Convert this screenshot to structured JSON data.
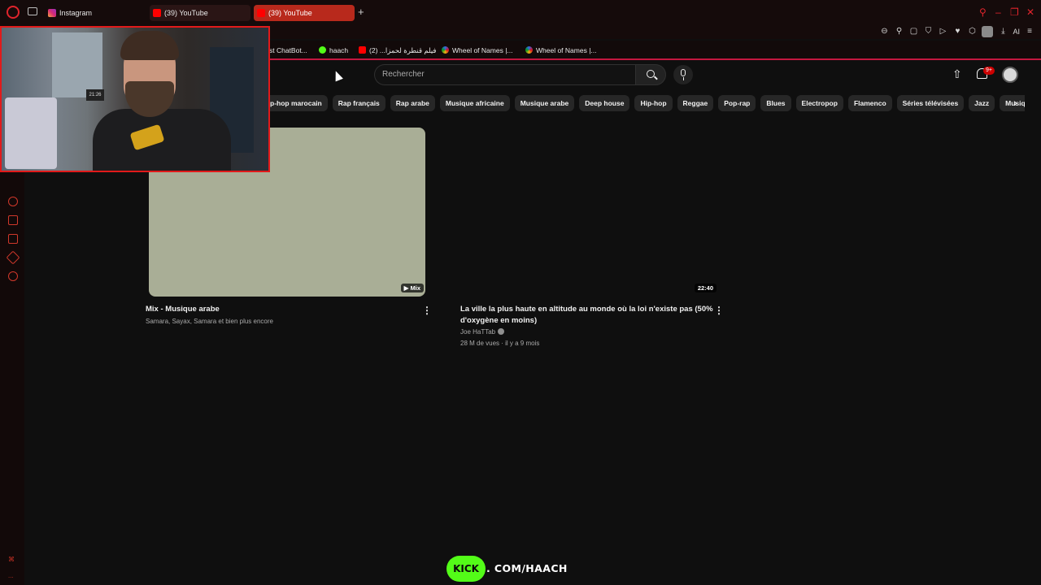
{
  "browser": {
    "tabs": [
      {
        "label": "Instagram",
        "icon": "instagram-icon"
      },
      {
        "label": "(39) YouTube",
        "icon": "youtube-icon"
      },
      {
        "label": "(39) YouTube",
        "icon": "youtube-icon",
        "active": true
      }
    ],
    "new_tab": "+",
    "toolbar_ai_label": "AI",
    "accent_color": "#e0242c"
  },
  "bookmarks": [
    {
      "label": "st ChatBot...",
      "icon": "chatbot-icon"
    },
    {
      "label": "haach",
      "icon": "kick-icon"
    },
    {
      "label": "فيلم قنطرة لحمزا... (2)",
      "icon": "youtube-icon"
    },
    {
      "label": "Wheel of Names |...",
      "icon": "wheel-icon"
    },
    {
      "label": "Wheel of Names |...",
      "icon": "wheel-icon"
    }
  ],
  "youtube": {
    "search_placeholder": "Rechercher",
    "notification_count": "9+",
    "chips": [
      "p-hop marocain",
      "Rap français",
      "Rap arabe",
      "Musique africaine",
      "Musique arabe",
      "Deep house",
      "Hip-hop",
      "Reggae",
      "Pop-rap",
      "Blues",
      "Electropop",
      "Flamenco",
      "Séries télévisées",
      "Jazz",
      "Musique"
    ],
    "videos": [
      {
        "title": "Mix - Musique arabe",
        "subtitle": "Samara, Sayax, Samara et bien plus encore",
        "badge": "Mix",
        "thumb_color": "#a9ae96"
      },
      {
        "title_line1": "La ville la plus haute en altitude au monde où la loi n'existe pas (50%",
        "title_line2": "d'oxygène en moins)",
        "channel": "Joe HaTTab",
        "meta": "28 M de vues · il y a 9 mois",
        "duration": "22:40"
      }
    ]
  },
  "overlay": {
    "kick_logo": "KICK",
    "kick_url": ". COM/HAACH",
    "webcam_clock": "21:26",
    "kick_color": "#53fc18"
  },
  "sidebar_bottom": [
    "⌘",
    "..."
  ]
}
